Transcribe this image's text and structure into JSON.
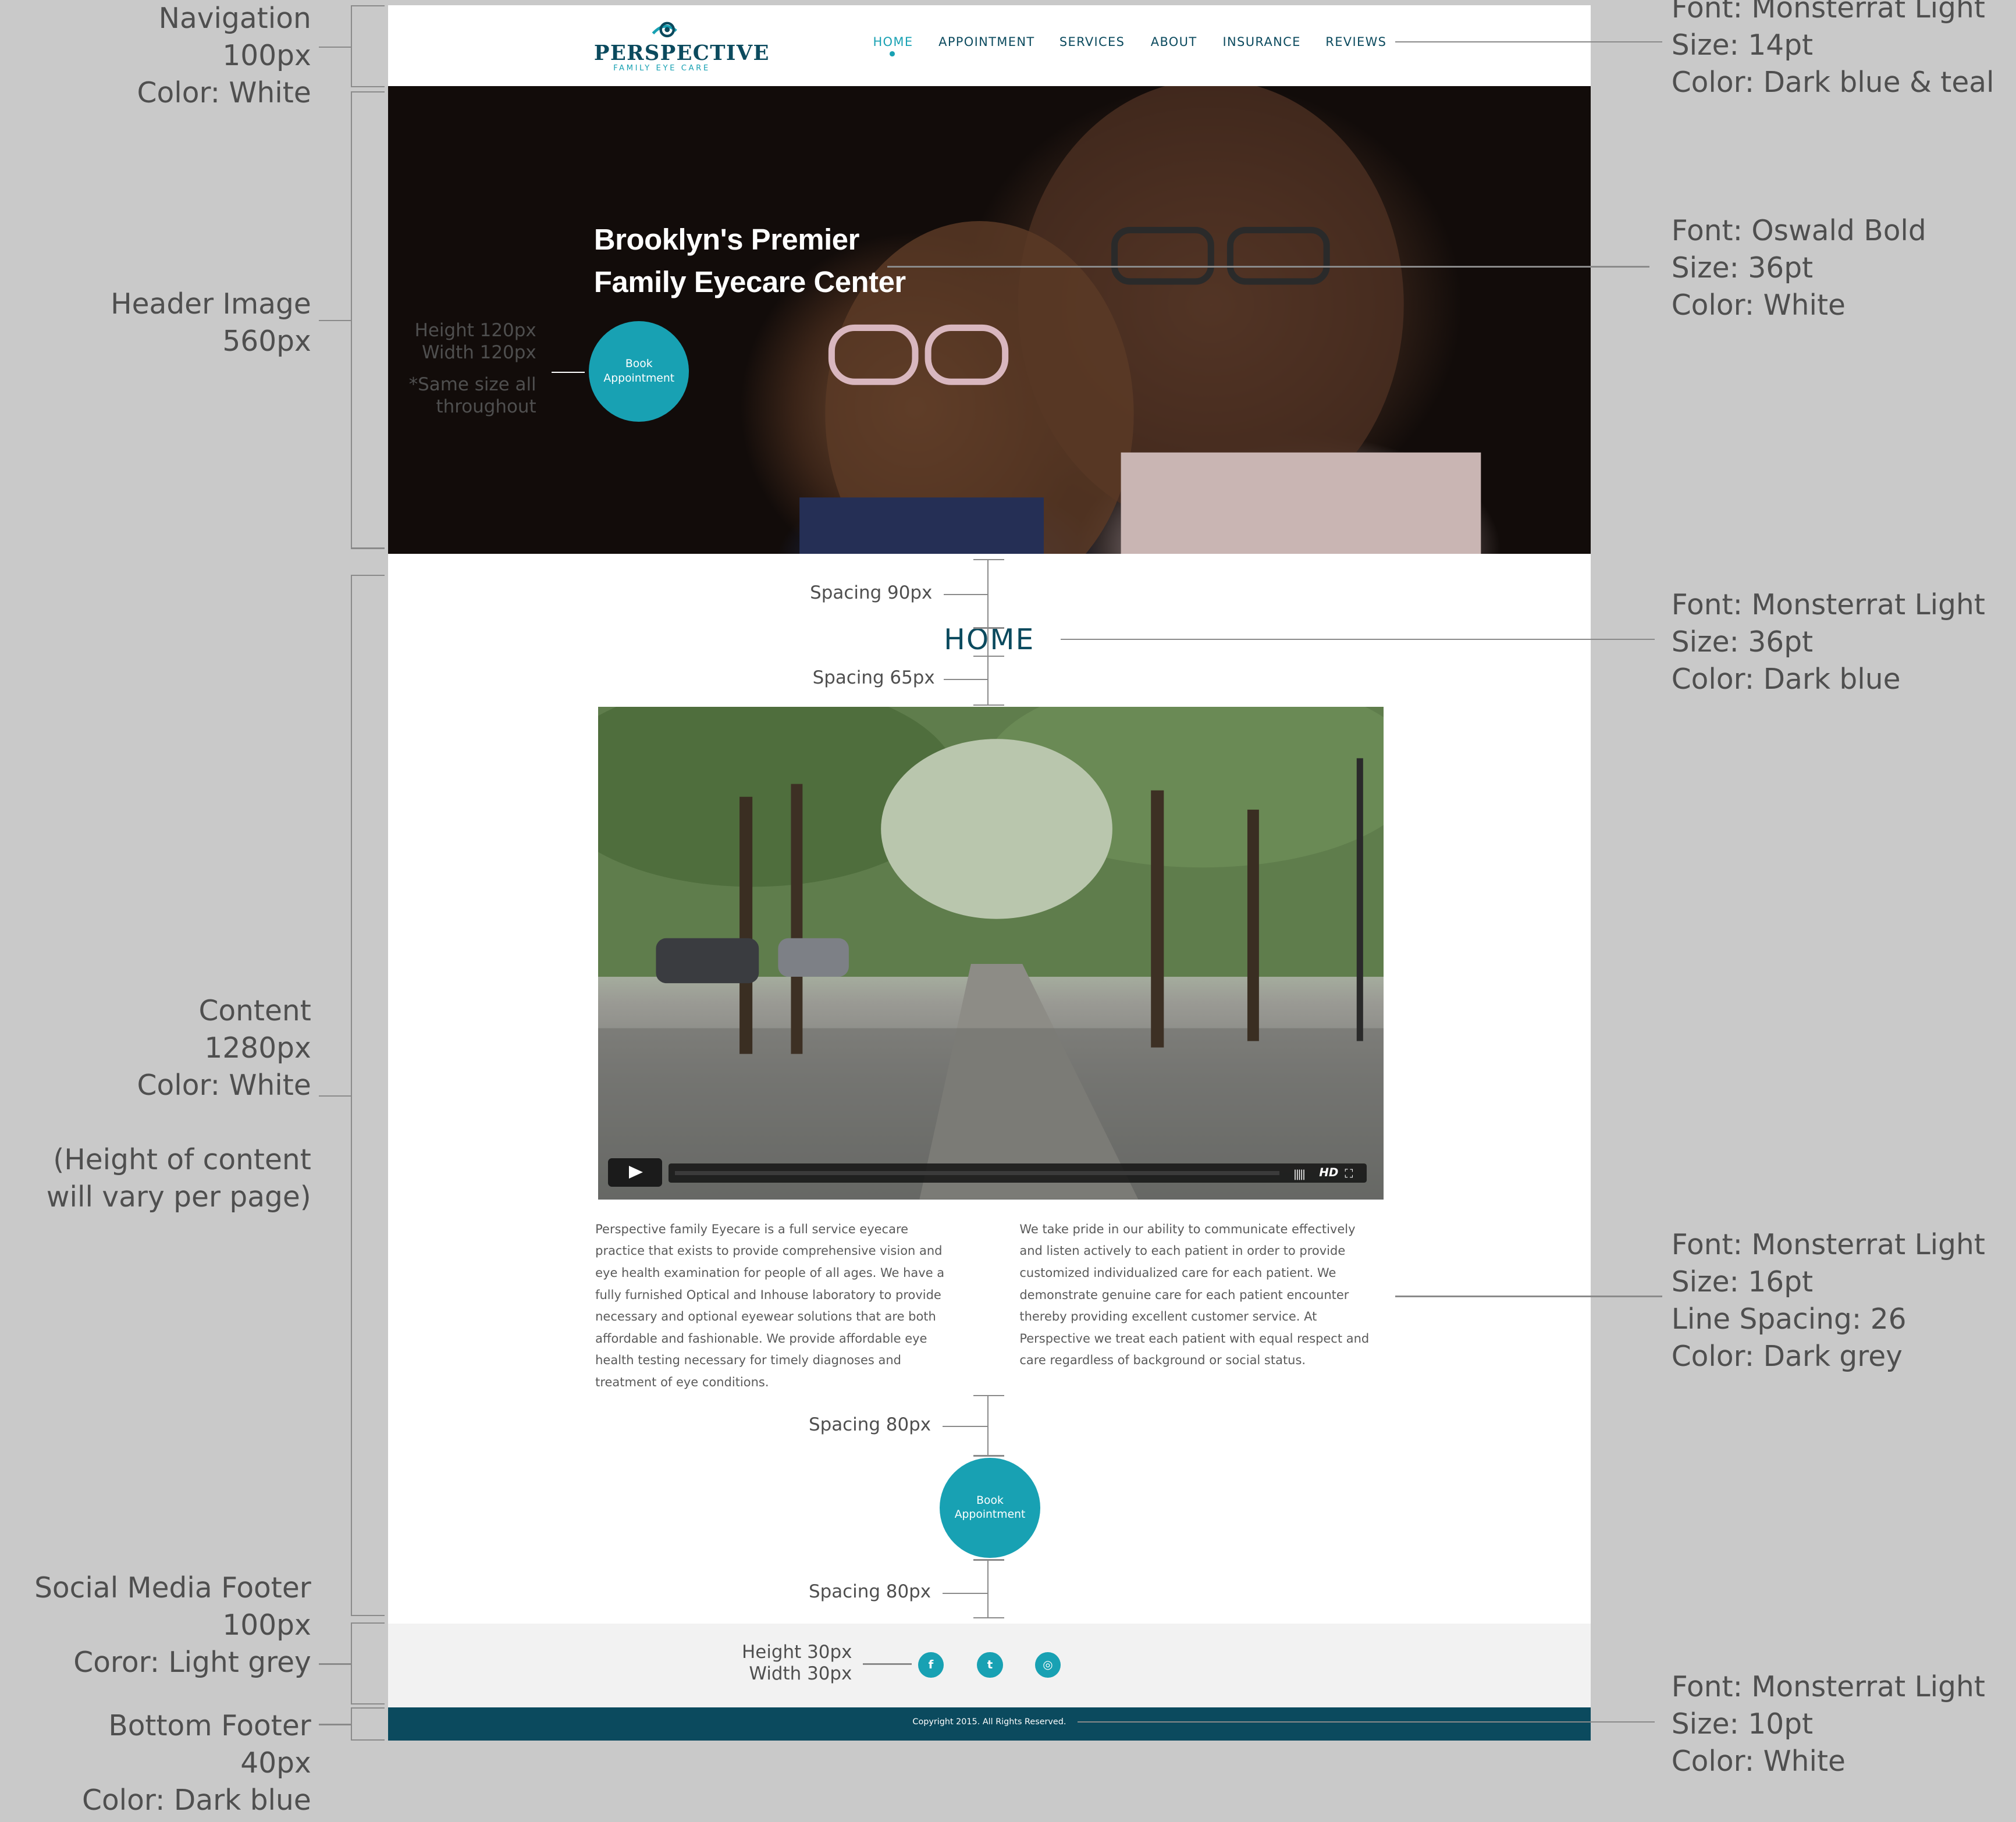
{
  "colors": {
    "teal": "#18a1b3",
    "dark_blue": "#0b4a5e",
    "light_grey": "#f2f2f2",
    "canvas": "#c9c9c9"
  },
  "nav": {
    "logo_word": "PERSPECTIVE",
    "logo_tagline": "FAMILY EYE CARE",
    "items": [
      {
        "label": "HOME",
        "active": true
      },
      {
        "label": "APPOINTMENT",
        "active": false
      },
      {
        "label": "SERVICES",
        "active": false
      },
      {
        "label": "ABOUT",
        "active": false
      },
      {
        "label": "INSURANCE",
        "active": false
      },
      {
        "label": "REVIEWS",
        "active": false
      }
    ]
  },
  "hero": {
    "title_line1": "Brooklyn's Premier",
    "title_line2": "Family Eyecare Center",
    "book_line1": "Book",
    "book_line2": "Appointment"
  },
  "content": {
    "heading": "HOME",
    "video": {
      "hd_label": "HD",
      "play_icon": "play-icon",
      "volume_icon": "volume-icon",
      "fullscreen_icon": "fullscreen-icon"
    },
    "para_left": "Perspective family Eyecare is a full service eyecare practice that exists to provide comprehensive vision and eye health examination for people of all ages. We have a fully furnished Optical and Inhouse laboratory to provide necessary and optional eyewear solutions that are both affordable and fashionable. We provide affordable eye health testing necessary for timely diagnoses and treatment of eye conditions.",
    "para_right": "We take pride in our ability to communicate effectively and listen actively to each patient in order to provide customized individualized care for each patient. We demonstrate genuine care for each patient encounter thereby providing excellent customer service. At Perspective we treat each patient with equal respect and care regardless of background or social status.",
    "book_line1": "Book",
    "book_line2": "Appointment"
  },
  "social": {
    "icons": [
      "facebook-icon",
      "twitter-icon",
      "instagram-icon"
    ],
    "facebook_glyph": "f",
    "twitter_glyph": "t",
    "instagram_glyph": "◎"
  },
  "footer": {
    "copyright": "Copyright 2015. All Rights Reserved."
  },
  "annotations": {
    "navigation": [
      "Navigation",
      "100px",
      "Color: White"
    ],
    "header_image": [
      "Header Image",
      "560px"
    ],
    "content": [
      "Content",
      "1280px",
      "Color: White"
    ],
    "content_note": [
      "(Height of content",
      "will vary per page)"
    ],
    "social_footer": [
      "Social Media Footer",
      "100px",
      "Coror: Light grey"
    ],
    "bottom_footer": [
      "Bottom Footer",
      "40px",
      "Color: Dark blue"
    ],
    "nav_font": [
      "Font: Monsterrat Light",
      "Size: 14pt",
      "Color: Dark blue & teal"
    ],
    "hero_font": [
      "Font: Oswald Bold",
      "Size: 36pt",
      "Color: White"
    ],
    "heading_font": [
      "Font: Monsterrat Light",
      "Size: 36pt",
      "Color: Dark blue"
    ],
    "body_font": [
      "Font: Monsterrat Light",
      "Size: 16pt",
      "Line Spacing: 26",
      "Color: Dark grey"
    ],
    "footer_font": [
      "Font: Monsterrat Light",
      "Size: 10pt",
      "Color: White"
    ],
    "button_size": [
      "Height 120px",
      "Width 120px",
      "*Same size all",
      "throughout"
    ],
    "spacing_90": "Spacing 90px",
    "spacing_65": "Spacing 65px",
    "spacing_80a": "Spacing 80px",
    "spacing_80b": "Spacing 80px",
    "social_size": [
      "Height 30px",
      "Width 30px"
    ]
  }
}
